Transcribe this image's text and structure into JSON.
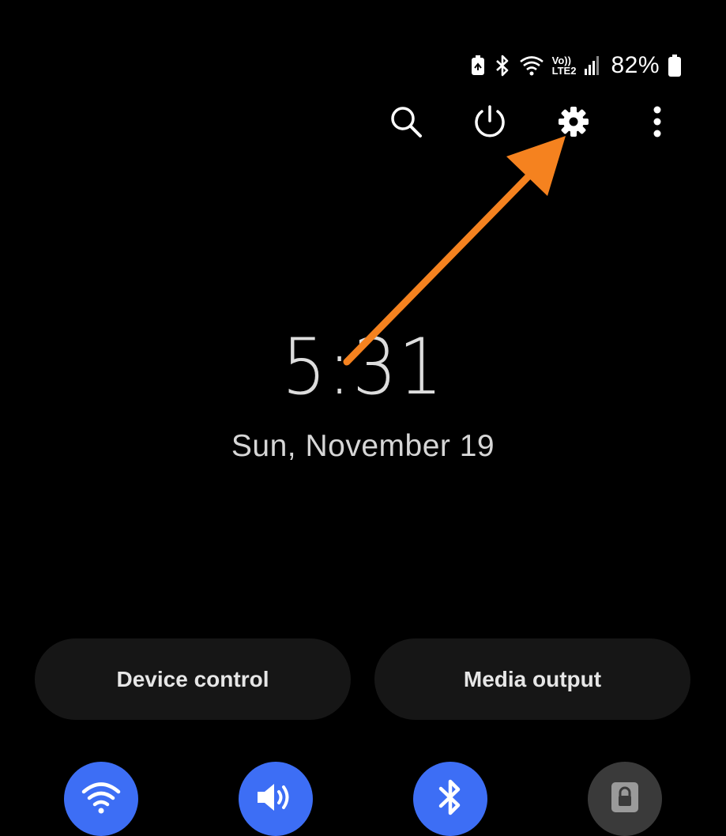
{
  "status_bar": {
    "icons": [
      "battery-saver-icon",
      "bluetooth-icon",
      "wifi-icon",
      "volte-lte2-icon",
      "signal-icon",
      "battery-icon"
    ],
    "volte_label": "Vo))",
    "lte_label": "LTE2",
    "battery_percent": "82%"
  },
  "actions": [
    {
      "name": "search-icon"
    },
    {
      "name": "power-icon"
    },
    {
      "name": "settings-gear-icon"
    },
    {
      "name": "more-options-icon"
    }
  ],
  "clock": {
    "time": "5:31",
    "date": "Sun, November 19"
  },
  "buttons": {
    "device_control": "Device control",
    "media_output": "Media output"
  },
  "toggles": [
    {
      "name": "wifi-icon",
      "state": "on"
    },
    {
      "name": "sound-icon",
      "state": "on"
    },
    {
      "name": "bluetooth-icon",
      "state": "on"
    },
    {
      "name": "lock-icon",
      "state": "off"
    }
  ],
  "colors": {
    "accent": "#3d6ef5",
    "annotation_arrow": "#f5821f",
    "background": "#000000"
  }
}
